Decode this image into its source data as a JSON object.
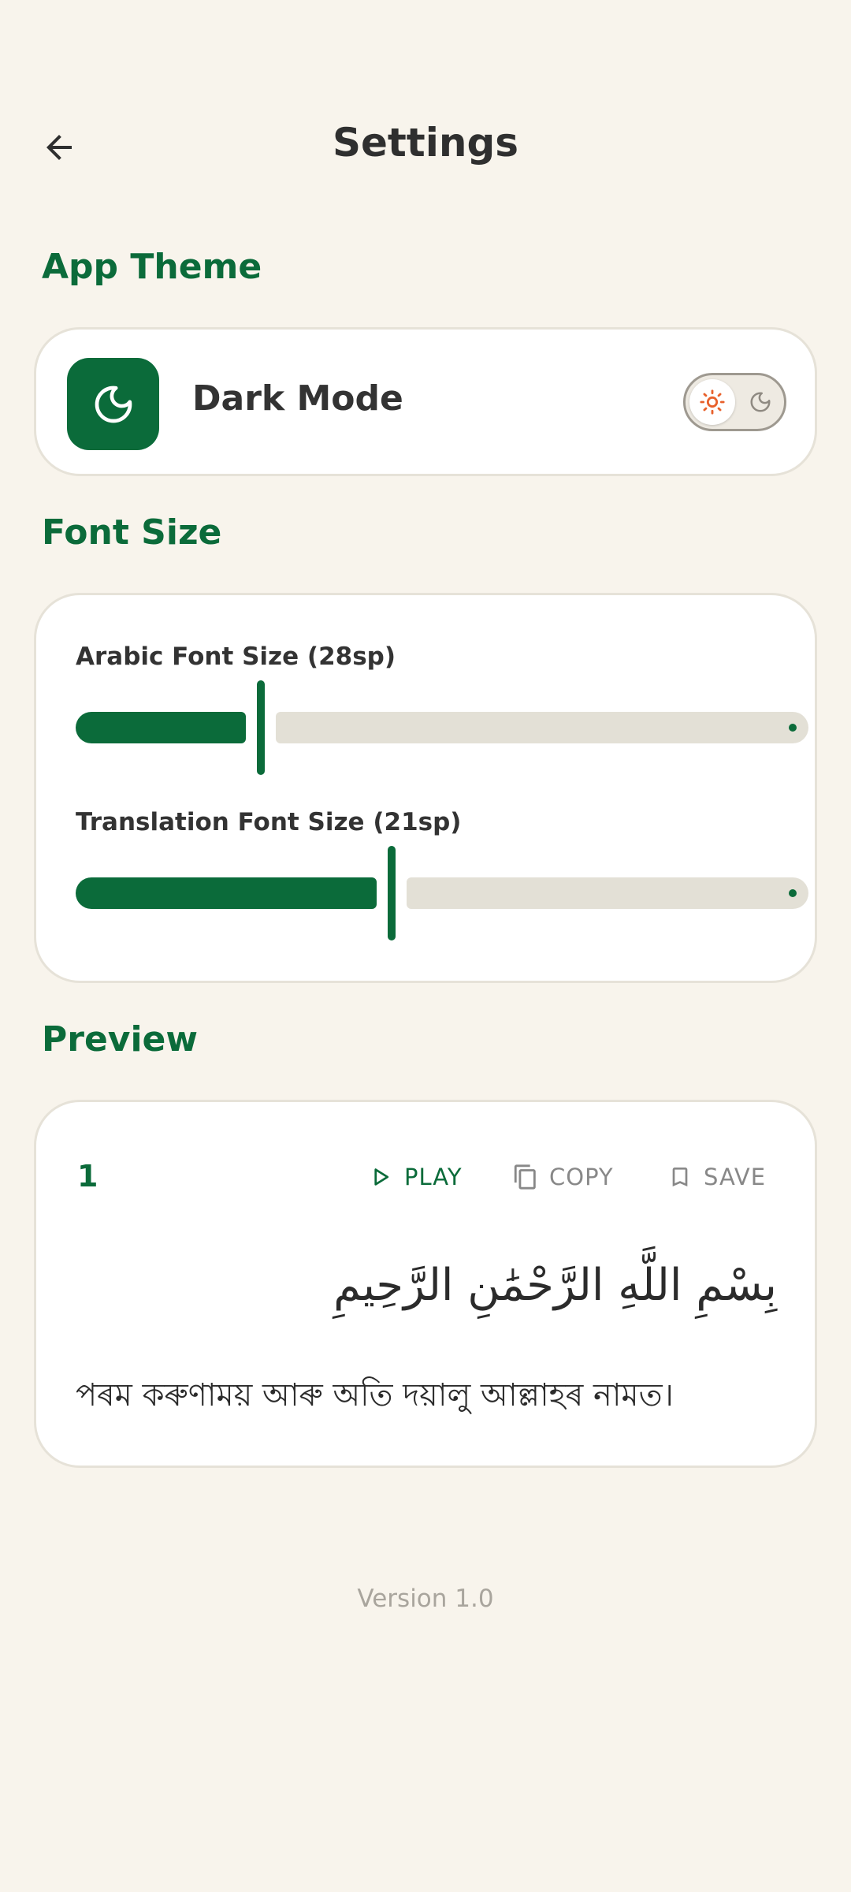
{
  "header": {
    "title": "Settings",
    "back_icon": "arrow-back-icon"
  },
  "theme_section": {
    "title": "App Theme",
    "dark_mode_label": "Dark Mode",
    "dark_mode_enabled": false,
    "icons": {
      "card": "moon-icon",
      "toggle_on": "sun-icon",
      "toggle_off": "moon-icon"
    }
  },
  "font_section": {
    "title": "Font Size",
    "arabic": {
      "label": "Arabic Font Size (28sp)",
      "value": 28,
      "level": 0.25
    },
    "translation": {
      "label": "Translation Font Size (21sp)",
      "value": 21,
      "level": 0.43
    }
  },
  "preview_section": {
    "title": "Preview",
    "verse_number": "1",
    "actions": {
      "play": "PLAY",
      "copy": "COPY",
      "save": "SAVE"
    },
    "arabic_text": "بِسْمِ اللَّهِ الرَّحْمَٰنِ الرَّحِيمِ",
    "translation_text": "পৰম কৰুণাময় আৰু অতি দয়ালু আল্লাহৰ নামত।"
  },
  "footer": {
    "version": "Version 1.0"
  },
  "colors": {
    "accent": "#0B6B3A",
    "background": "#F8F4EC",
    "sun": "#E8612C"
  }
}
